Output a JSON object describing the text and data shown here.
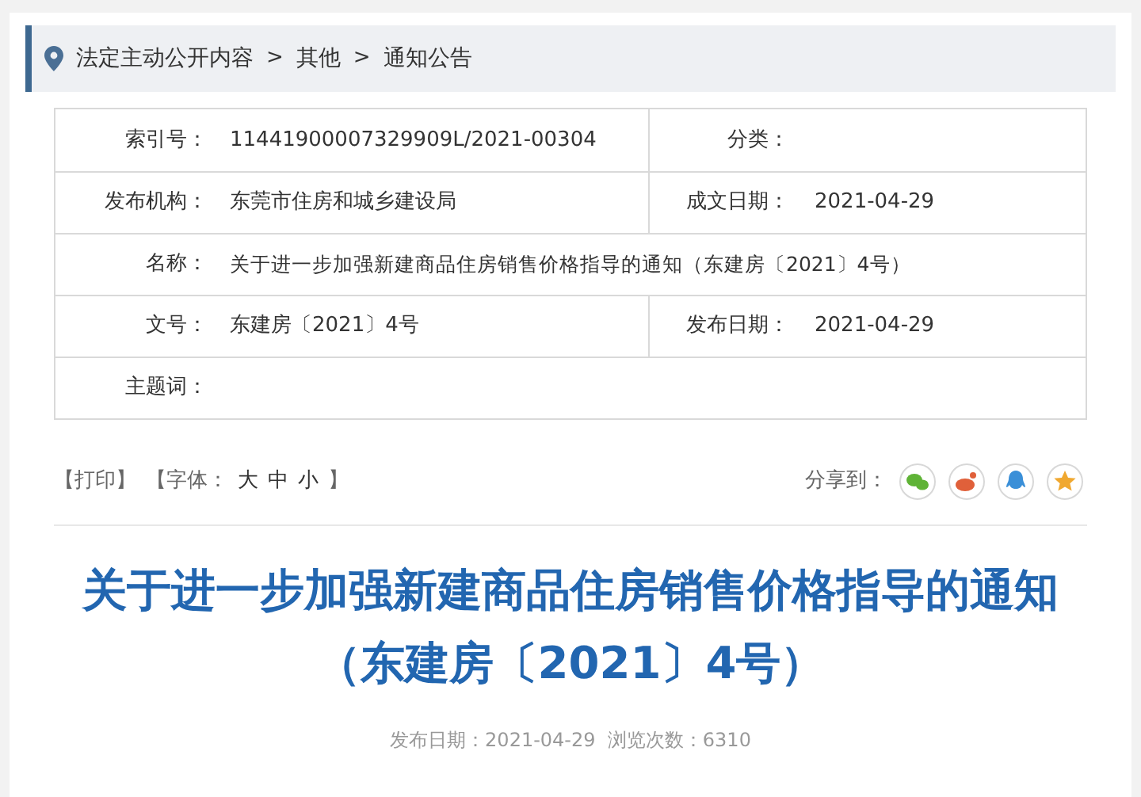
{
  "breadcrumb": {
    "items": [
      "法定主动公开内容",
      "其他",
      "通知公告"
    ],
    "separator": ">"
  },
  "info_table": {
    "rows": [
      {
        "kind": "pair",
        "cells": [
          {
            "label": "索引号：",
            "value": "11441900007329909L/2021-00304"
          },
          {
            "label": "分类："
          }
        ]
      },
      {
        "kind": "pair",
        "cells": [
          {
            "label": "发布机构：",
            "value": "东莞市住房和城乡建设局"
          },
          {
            "label": "成文日期：",
            "value": "2021-04-29"
          }
        ]
      },
      {
        "kind": "full",
        "cells": [
          {
            "label": "名称：",
            "value": "关于进一步加强新建商品住房销售价格指导的通知（东建房〔2021〕4号）"
          }
        ]
      },
      {
        "kind": "pair",
        "cells": [
          {
            "label": "文号：",
            "value": "东建房〔2021〕4号"
          },
          {
            "label": "发布日期：",
            "value": "2021-04-29"
          }
        ]
      },
      {
        "kind": "full",
        "cells": [
          {
            "label": "主题词："
          }
        ]
      }
    ]
  },
  "toolbar": {
    "print": "【打印】",
    "font_size_label": "【字体：",
    "font_sizes": [
      "大",
      "中",
      "小"
    ],
    "font_size_end": "】",
    "share_label": "分享到：",
    "share_targets": [
      {
        "kind": "wechat",
        "color": "#5fb336"
      },
      {
        "kind": "weibo",
        "color": "#e0603a"
      },
      {
        "kind": "qq",
        "color": "#3a8fd8"
      },
      {
        "kind": "favorite",
        "color": "#f0a830"
      }
    ]
  },
  "article": {
    "title_lines": [
      "关于进一步加强新建商品住房销售价格指导的通知",
      "（东建房〔2021〕4号）"
    ],
    "meta": "发布日期：2021-04-29  浏览次数：6310"
  }
}
